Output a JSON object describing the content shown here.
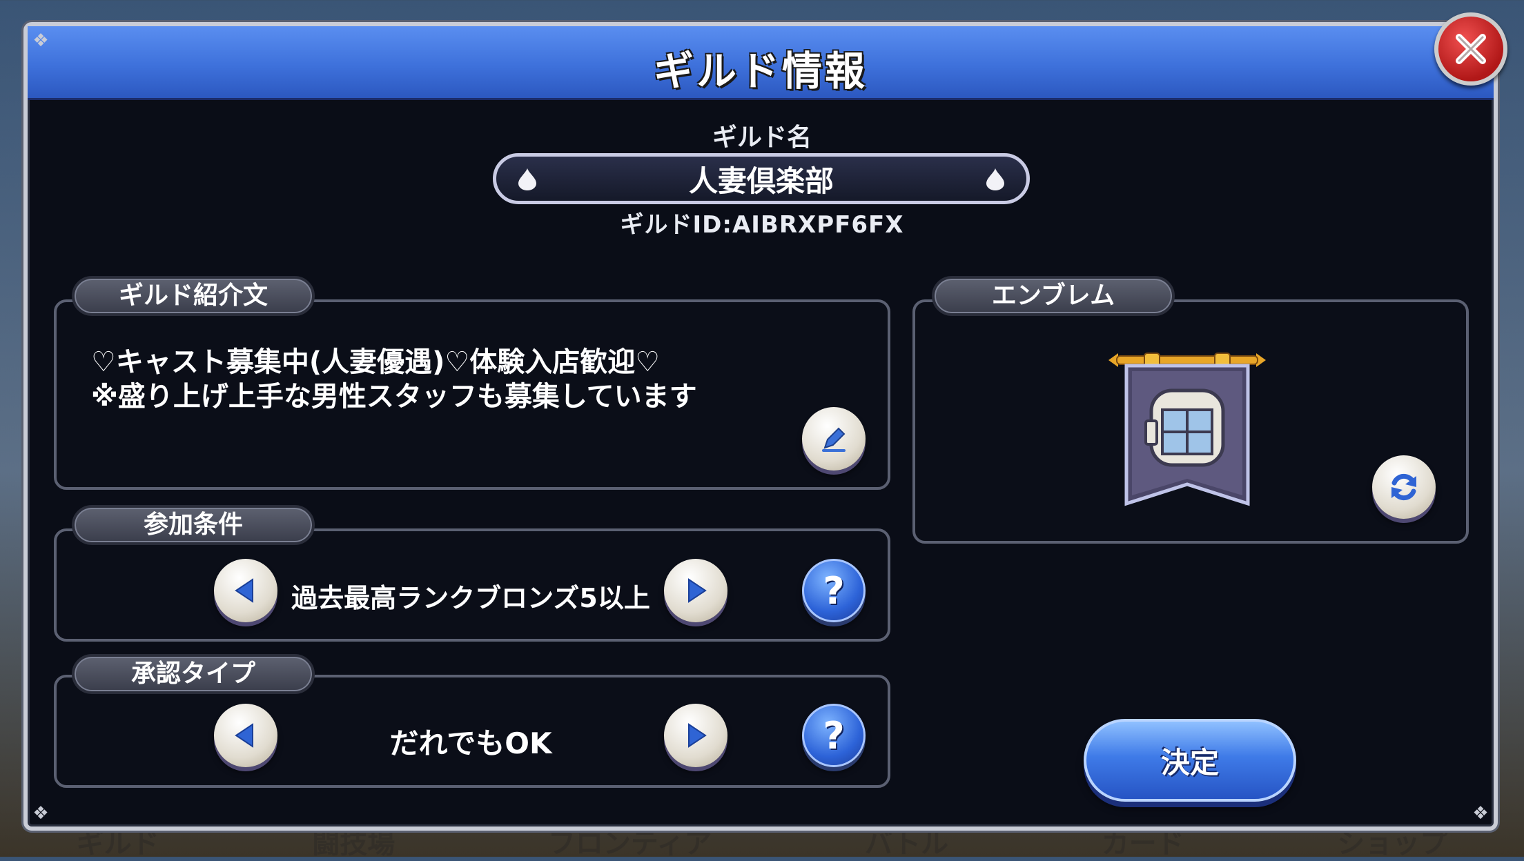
{
  "background_nav": [
    "ギルド",
    "闘技場",
    "フロンティア",
    "バトル",
    "カード",
    "ショップ"
  ],
  "dialog": {
    "title": "ギルド情報",
    "close_icon": "close-icon"
  },
  "guild_name": {
    "label": "ギルド名",
    "value": "人妻倶楽部",
    "id_text": "ギルドID:AIBRXPF6FX"
  },
  "intro": {
    "tab_label": "ギルド紹介文",
    "line1": "♡キャスト募集中(人妻優遇)♡体験入店歓迎♡",
    "line2": "※盛り上げ上手な男性スタッフも募集しています",
    "edit_icon": "pencil-icon"
  },
  "join_condition": {
    "tab_label": "参加条件",
    "value": "過去最高ランクブロンズ5以上",
    "help": "?"
  },
  "approval_type": {
    "tab_label": "承認タイプ",
    "value": "だれでもOK",
    "help": "?"
  },
  "emblem": {
    "tab_label": "エンブレム",
    "icon": "banner-emblem-icon",
    "refresh_icon": "refresh-icon"
  },
  "submit_label": "決定",
  "colors": {
    "title_bar": "#3e71db",
    "panel_bg": "#0a0d17",
    "close_red": "#d12424",
    "accent_blue": "#2d63d8"
  }
}
